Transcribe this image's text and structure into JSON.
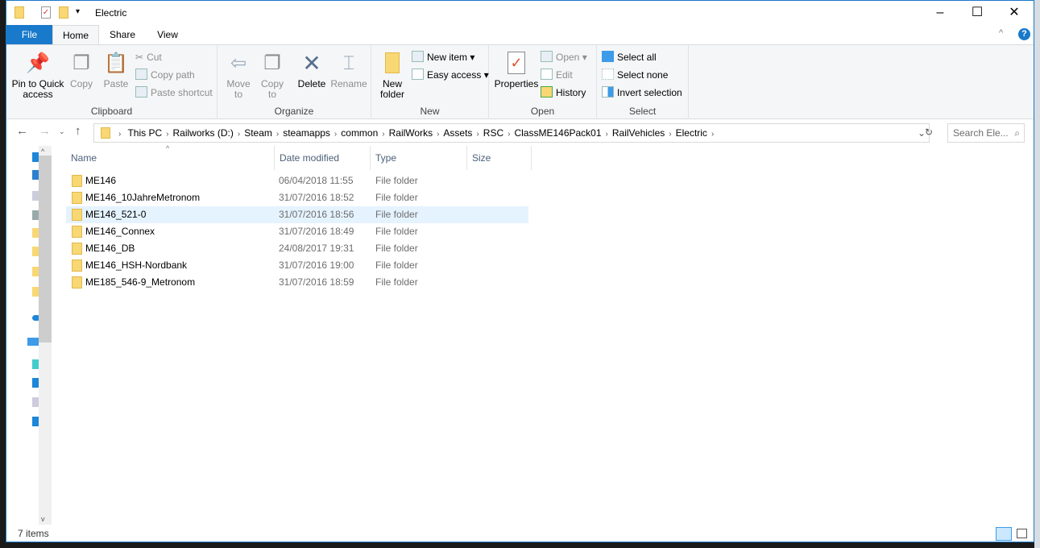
{
  "window": {
    "title": "Electric",
    "minimize": "–",
    "maximize": "☐",
    "close": "✕"
  },
  "tabs": [
    "File",
    "Home",
    "Share",
    "View"
  ],
  "ribbon": {
    "clipboard": {
      "label": "Clipboard",
      "pin": "Pin to Quick access",
      "copy": "Copy",
      "paste": "Paste",
      "cut": "Cut",
      "copy_path": "Copy path",
      "paste_shortcut": "Paste shortcut"
    },
    "organize": {
      "label": "Organize",
      "move_to": "Move to",
      "copy_to": "Copy to",
      "delete": "Delete",
      "rename": "Rename"
    },
    "new": {
      "label": "New",
      "new_folder": "New folder",
      "new_item": "New item",
      "easy_access": "Easy access"
    },
    "open": {
      "label": "Open",
      "properties": "Properties",
      "open": "Open",
      "edit": "Edit",
      "history": "History"
    },
    "select": {
      "label": "Select",
      "select_all": "Select all",
      "select_none": "Select none",
      "invert": "Invert selection"
    }
  },
  "address": {
    "crumbs": [
      "This PC",
      "Railworks (D:)",
      "Steam",
      "steamapps",
      "common",
      "RailWorks",
      "Assets",
      "RSC",
      "ClassME146Pack01",
      "RailVehicles",
      "Electric"
    ],
    "search_placeholder": "Search Ele..."
  },
  "columns": [
    "Name",
    "Date modified",
    "Type",
    "Size"
  ],
  "files": [
    {
      "name": "ME146",
      "date": "06/04/2018 11:55",
      "type": "File folder"
    },
    {
      "name": "ME146_10JahreMetronom",
      "date": "31/07/2016 18:52",
      "type": "File folder"
    },
    {
      "name": "ME146_521-0",
      "date": "31/07/2016 18:56",
      "type": "File folder"
    },
    {
      "name": "ME146_Connex",
      "date": "31/07/2016 18:49",
      "type": "File folder"
    },
    {
      "name": "ME146_DB",
      "date": "24/08/2017 19:31",
      "type": "File folder"
    },
    {
      "name": "ME146_HSH-Nordbank",
      "date": "31/07/2016 19:00",
      "type": "File folder"
    },
    {
      "name": "ME185_546-9_Metronom",
      "date": "31/07/2016 18:59",
      "type": "File folder"
    }
  ],
  "status": "7 items"
}
